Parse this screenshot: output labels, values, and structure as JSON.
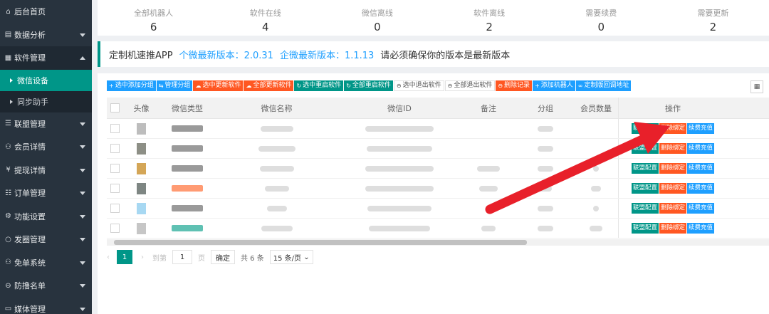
{
  "sidebar": {
    "items": [
      {
        "icon": "⌂",
        "label": "后台首页",
        "arrow": ""
      },
      {
        "icon": "▤",
        "label": "数据分析",
        "arrow": "down"
      },
      {
        "icon": "▦",
        "label": "软件管理",
        "arrow": "up"
      },
      {
        "icon": "",
        "label": "微信设备",
        "arrow": ""
      },
      {
        "icon": "",
        "label": "同步助手",
        "arrow": ""
      },
      {
        "icon": "☰",
        "label": "联盟管理",
        "arrow": "down"
      },
      {
        "icon": "⚇",
        "label": "会员详情",
        "arrow": "down"
      },
      {
        "icon": "¥",
        "label": "提现详情",
        "arrow": "down"
      },
      {
        "icon": "☷",
        "label": "订单管理",
        "arrow": "down"
      },
      {
        "icon": "⚙",
        "label": "功能设置",
        "arrow": "down"
      },
      {
        "icon": "○",
        "label": "发圈管理",
        "arrow": "down"
      },
      {
        "icon": "⚇",
        "label": "免单系统",
        "arrow": "down"
      },
      {
        "icon": "⊖",
        "label": "防撸名单",
        "arrow": "down"
      },
      {
        "icon": "▭",
        "label": "媒体管理",
        "arrow": "down"
      }
    ]
  },
  "stats": [
    {
      "label": "全部机器人",
      "value": "6"
    },
    {
      "label": "软件在线",
      "value": "4"
    },
    {
      "label": "微信离线",
      "value": "0"
    },
    {
      "label": "软件离线",
      "value": "2"
    },
    {
      "label": "需要续费",
      "value": "0"
    },
    {
      "label": "需要更新",
      "value": "2"
    }
  ],
  "notice": {
    "prefix": "定制机速推APP",
    "personal": "个微最新版本：2.0.31",
    "enterprise": "企微最新版本：1.1.13",
    "suffix": "请必须确保你的版本是最新版本"
  },
  "toolbar": [
    {
      "label": "选中添加分组",
      "color": "blue",
      "icon": "+"
    },
    {
      "label": "管理分组",
      "color": "blue",
      "icon": "⇆"
    },
    {
      "label": "选中更新软件",
      "color": "orange",
      "icon": "☁"
    },
    {
      "label": "全部更新软件",
      "color": "orange",
      "icon": "☁"
    },
    {
      "label": "选中重启软件",
      "color": "green",
      "icon": "↻"
    },
    {
      "label": "全部重启软件",
      "color": "green",
      "icon": "↻"
    },
    {
      "label": "选中退出软件",
      "color": "white",
      "icon": "⊖"
    },
    {
      "label": "全部退出软件",
      "color": "white",
      "icon": "⊖"
    },
    {
      "label": "删除记录",
      "color": "orange",
      "icon": "⊖"
    },
    {
      "label": "添加机器人",
      "color": "blue",
      "icon": "+"
    },
    {
      "label": "定制版回调地址",
      "color": "blue",
      "icon": "∞"
    }
  ],
  "table": {
    "headers": [
      "头像",
      "微信类型",
      "微信名称",
      "微信ID",
      "备注",
      "分组",
      "会员数量",
      "操作"
    ],
    "rows": [
      {
        "badge": "gray"
      },
      {
        "badge": "gray"
      },
      {
        "badge": "gray"
      },
      {
        "badge": "orange"
      },
      {
        "badge": "gray"
      },
      {
        "badge": "teal"
      }
    ],
    "ops": [
      "联盟配置",
      "删除绑定",
      "续费充值"
    ]
  },
  "pager": {
    "page": "1",
    "goto_label": "到第",
    "input_value": "1",
    "page_unit": "页",
    "confirm": "确定",
    "total": "共 6 条",
    "page_size": "15 条/页"
  },
  "colors": {
    "sidebar": "#28333e",
    "accent": "#009688",
    "blue": "#1e9fff",
    "orange": "#ff5722",
    "arrow": "#e8202a"
  }
}
